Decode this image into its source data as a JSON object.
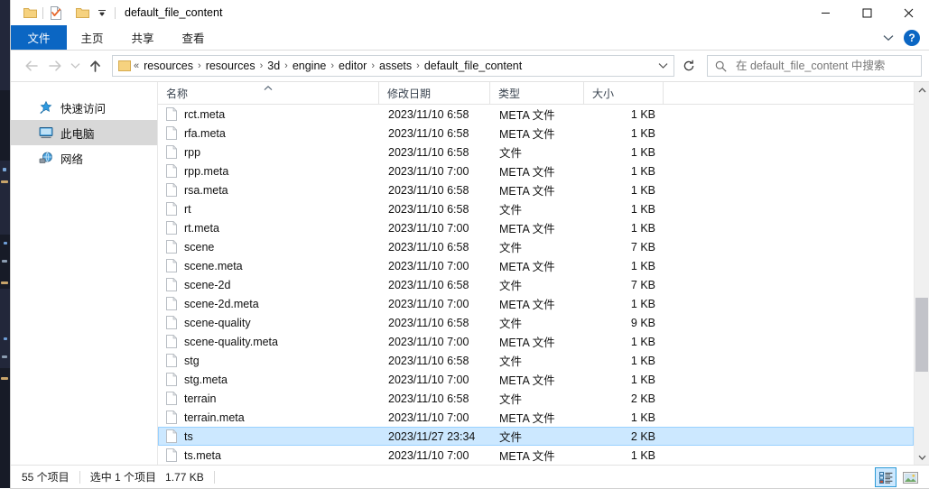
{
  "window": {
    "title": "default_file_content",
    "minimize_label": "最小化",
    "maximize_label": "最大化",
    "close_label": "关闭"
  },
  "quick_access_toolbar": {
    "items": [
      {
        "name": "folder-icon",
        "label": "属性"
      },
      {
        "name": "properties-icon",
        "label": "属性"
      },
      {
        "name": "new-folder-icon",
        "label": "新建文件夹"
      },
      {
        "name": "customize-dropdown-icon",
        "label": "自定义快速访问工具栏"
      }
    ]
  },
  "ribbon": {
    "tabs": [
      {
        "label": "文件",
        "active": true
      },
      {
        "label": "主页",
        "active": false
      },
      {
        "label": "共享",
        "active": false
      },
      {
        "label": "查看",
        "active": false
      }
    ],
    "expand_label": "展开功能区",
    "help_label": "?"
  },
  "navigation": {
    "back_label": "后退",
    "forward_label": "前进",
    "recent_label": "最近浏览的位置",
    "up_label": "上移一级",
    "refresh_label": "刷新",
    "breadcrumb": {
      "prefix": "«",
      "parts": [
        "resources",
        "resources",
        "3d",
        "engine",
        "editor",
        "assets",
        "default_file_content"
      ],
      "separator": "›"
    }
  },
  "search": {
    "placeholder": "在 default_file_content 中搜索",
    "value": "",
    "icon": "search-icon"
  },
  "sidebar": {
    "items": [
      {
        "label": "快速访问",
        "icon": "pin-star-icon",
        "selected": false
      },
      {
        "label": "此电脑",
        "icon": "computer-monitor-icon",
        "selected": true
      },
      {
        "label": "网络",
        "icon": "network-globe-icon",
        "selected": false
      }
    ]
  },
  "file_list": {
    "columns": [
      {
        "key": "name",
        "label": "名称",
        "sorted": "asc"
      },
      {
        "key": "date",
        "label": "修改日期",
        "sorted": null
      },
      {
        "key": "type",
        "label": "类型",
        "sorted": null
      },
      {
        "key": "size",
        "label": "大小",
        "sorted": null
      }
    ],
    "rows": [
      {
        "name": "rct.meta",
        "date": "2023/11/10 6:58",
        "type": "META 文件",
        "size": "1 KB",
        "selected": false
      },
      {
        "name": "rfa.meta",
        "date": "2023/11/10 6:58",
        "type": "META 文件",
        "size": "1 KB",
        "selected": false
      },
      {
        "name": "rpp",
        "date": "2023/11/10 6:58",
        "type": "文件",
        "size": "1 KB",
        "selected": false
      },
      {
        "name": "rpp.meta",
        "date": "2023/11/10 7:00",
        "type": "META 文件",
        "size": "1 KB",
        "selected": false
      },
      {
        "name": "rsa.meta",
        "date": "2023/11/10 6:58",
        "type": "META 文件",
        "size": "1 KB",
        "selected": false
      },
      {
        "name": "rt",
        "date": "2023/11/10 6:58",
        "type": "文件",
        "size": "1 KB",
        "selected": false
      },
      {
        "name": "rt.meta",
        "date": "2023/11/10 7:00",
        "type": "META 文件",
        "size": "1 KB",
        "selected": false
      },
      {
        "name": "scene",
        "date": "2023/11/10 6:58",
        "type": "文件",
        "size": "7 KB",
        "selected": false
      },
      {
        "name": "scene.meta",
        "date": "2023/11/10 7:00",
        "type": "META 文件",
        "size": "1 KB",
        "selected": false
      },
      {
        "name": "scene-2d",
        "date": "2023/11/10 6:58",
        "type": "文件",
        "size": "7 KB",
        "selected": false
      },
      {
        "name": "scene-2d.meta",
        "date": "2023/11/10 7:00",
        "type": "META 文件",
        "size": "1 KB",
        "selected": false
      },
      {
        "name": "scene-quality",
        "date": "2023/11/10 6:58",
        "type": "文件",
        "size": "9 KB",
        "selected": false
      },
      {
        "name": "scene-quality.meta",
        "date": "2023/11/10 7:00",
        "type": "META 文件",
        "size": "1 KB",
        "selected": false
      },
      {
        "name": "stg",
        "date": "2023/11/10 6:58",
        "type": "文件",
        "size": "1 KB",
        "selected": false
      },
      {
        "name": "stg.meta",
        "date": "2023/11/10 7:00",
        "type": "META 文件",
        "size": "1 KB",
        "selected": false
      },
      {
        "name": "terrain",
        "date": "2023/11/10 6:58",
        "type": "文件",
        "size": "2 KB",
        "selected": false
      },
      {
        "name": "terrain.meta",
        "date": "2023/11/10 7:00",
        "type": "META 文件",
        "size": "1 KB",
        "selected": false
      },
      {
        "name": "ts",
        "date": "2023/11/27 23:34",
        "type": "文件",
        "size": "2 KB",
        "selected": true
      },
      {
        "name": "ts.meta",
        "date": "2023/11/10 7:00",
        "type": "META 文件",
        "size": "1 KB",
        "selected": false
      }
    ]
  },
  "scrollbar": {
    "up_label": "向上滚动",
    "down_label": "向下滚动"
  },
  "status_bar": {
    "item_count": "55 个项目",
    "selection": "选中 1 个项目",
    "selection_size": "1.77 KB",
    "views": [
      {
        "name": "details-view-button",
        "label": "详细信息",
        "active": true
      },
      {
        "name": "large-icons-view-button",
        "label": "大图标",
        "active": false
      }
    ]
  },
  "colors": {
    "accent": "#0b66c3",
    "selection": "#cce8ff",
    "selection_border": "#99d1ff",
    "folder": "#f6d27f",
    "sidebar_selected": "#d8d8d8"
  }
}
